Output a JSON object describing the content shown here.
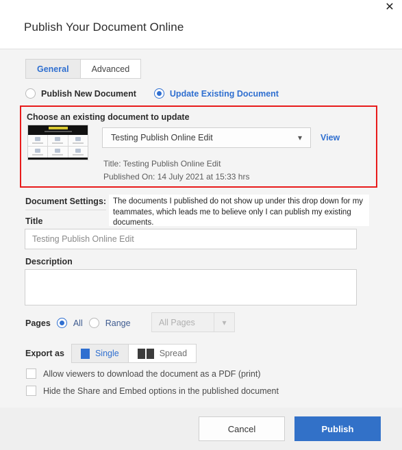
{
  "dialog": {
    "title": "Publish Your Document Online",
    "close_icon": "close-icon"
  },
  "tabs": [
    {
      "label": "General",
      "active": true
    },
    {
      "label": "Advanced",
      "active": false
    }
  ],
  "publish_mode": {
    "new_label": "Publish New Document",
    "update_label": "Update Existing Document",
    "selected": "Update Existing Document"
  },
  "existing_document": {
    "heading": "Choose an existing document to update",
    "selected_document": "Testing Publish Online Edit",
    "dropdown_icon": "chevron-down-icon",
    "view_link": "View",
    "title_line": "Title: Testing Publish Online Edit",
    "published_line": "Published On: 14 July 2021 at 15:33 hrs",
    "highlight_color": "#e81a1a"
  },
  "annotation": {
    "text": "The documents I published do not show up under this drop down for my teammates, which leads me to believe only I can publish my existing documents."
  },
  "document_settings": {
    "section_label": "Document Settings:",
    "title_label": "Title",
    "title_value": "Testing Publish Online Edit",
    "description_label": "Description",
    "description_value": ""
  },
  "pages": {
    "label": "Pages",
    "all_label": "All",
    "range_label": "Range",
    "selected": "All",
    "range_dropdown_value": "All Pages",
    "range_dropdown_icon": "chevron-down-icon"
  },
  "export_as": {
    "label": "Export as",
    "single_label": "Single",
    "spread_label": "Spread",
    "selected": "Single",
    "single_icon": "single-page-icon",
    "spread_icon": "spread-pages-icon"
  },
  "options": [
    {
      "label": "Allow viewers to download the document as a PDF (print)",
      "checked": false
    },
    {
      "label": "Hide the Share and Embed options in the published document",
      "checked": false
    }
  ],
  "footer": {
    "cancel_label": "Cancel",
    "publish_label": "Publish",
    "accent_color": "#3271c8"
  }
}
